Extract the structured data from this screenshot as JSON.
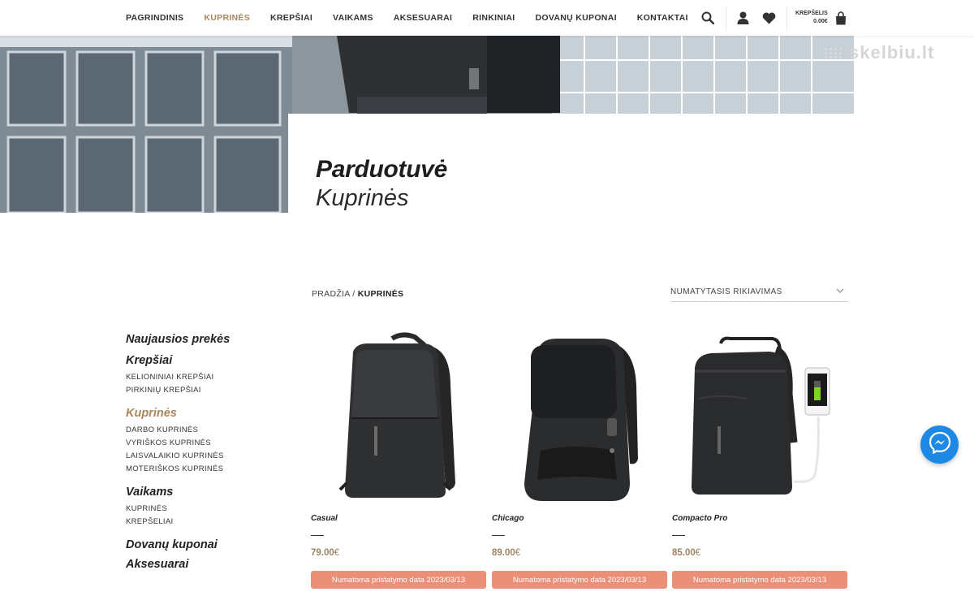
{
  "nav": {
    "items": [
      {
        "label": "PAGRINDINIS"
      },
      {
        "label": "KUPRINĖS",
        "active": true
      },
      {
        "label": "KREPŠIAI"
      },
      {
        "label": "VAIKAMS"
      },
      {
        "label": "AKSESUARAI"
      },
      {
        "label": "RINKINIAI"
      },
      {
        "label": "DOVANŲ KUPONAI"
      },
      {
        "label": "KONTAKTAI"
      }
    ],
    "accent_color": "#a9875a"
  },
  "header_icons": [
    "search-icon",
    "user-icon",
    "heart-icon",
    "bag-icon"
  ],
  "cart": {
    "label": "KREPŠELIS",
    "amount": "0.00€"
  },
  "watermark": "skelbiu.lt",
  "hero": {
    "title": "Parduotuvė",
    "subtitle": "Kuprinės"
  },
  "breadcrumb": {
    "home": "PRADŽIA",
    "separator": " / ",
    "current": "KUPRINĖS"
  },
  "sort": {
    "label": "NUMATYTASIS RIKIAVIMAS"
  },
  "sidebar": {
    "sections": [
      {
        "title": "Naujausios prekės",
        "items": []
      },
      {
        "title": "Krepšiai",
        "items": [
          "KELIONINIAI KREPŠIAI",
          "PIRKINIŲ KREPŠIAI"
        ]
      },
      {
        "title": "Kuprinės",
        "active": true,
        "items": [
          "DARBO KUPRINĖS",
          "VYRIŠKOS KUPRINĖS",
          "LAISVALAIKIO KUPRINĖS",
          "MOTERIŠKOS KUPRINĖS"
        ]
      },
      {
        "title": "Vaikams",
        "items": [
          "KUPRINĖS",
          "KREPŠELIAI"
        ]
      },
      {
        "title": "Dovanų kuponai",
        "items": []
      },
      {
        "title": "Aksesuarai",
        "items": []
      }
    ]
  },
  "products": [
    {
      "name": "Casual",
      "price": "79.00",
      "currency": "€",
      "delivery": "Numatoma pristatymo data 2023/03/13"
    },
    {
      "name": "Chicago",
      "price": "89.00",
      "currency": "€",
      "delivery": "Numatoma pristatymo data 2023/03/13"
    },
    {
      "name": "Compacto Pro",
      "price": "85.00",
      "currency": "€",
      "delivery": "Numatoma pristatymo data 2023/03/13"
    }
  ],
  "colors": {
    "button": "#ec8f78",
    "price": "#9c8463",
    "messenger": "#1e88e5"
  }
}
